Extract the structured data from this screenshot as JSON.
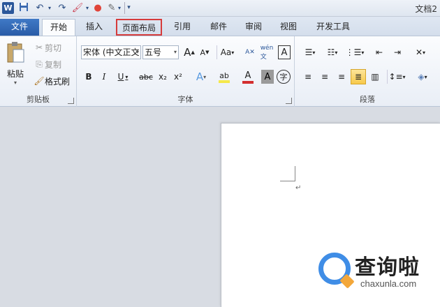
{
  "window": {
    "title": "文档2"
  },
  "qat": {
    "word_icon": "W",
    "save_icon": "💾",
    "undo_icon": "↶",
    "redo_icon": "↷",
    "paint_icon": "🖌",
    "color_icon": "●",
    "draw_icon": "✎",
    "more_icon": "▾"
  },
  "tabs": [
    {
      "label": "文件"
    },
    {
      "label": "开始"
    },
    {
      "label": "插入"
    },
    {
      "label": "页面布局"
    },
    {
      "label": "引用"
    },
    {
      "label": "邮件"
    },
    {
      "label": "审阅"
    },
    {
      "label": "视图"
    },
    {
      "label": "开发工具"
    }
  ],
  "clipboard": {
    "paste_label": "粘贴",
    "cut_label": "剪切",
    "copy_label": "复制",
    "format_painter_label": "格式刷",
    "group_label": "剪贴板"
  },
  "font": {
    "font_name": "宋体 (中文正文",
    "font_size": "五号",
    "grow_label": "A",
    "shrink_label": "A",
    "case_label": "Aa",
    "bold": "B",
    "italic": "I",
    "underline": "U",
    "strike": "abc",
    "subscript": "x₂",
    "superscript": "x²",
    "text_effect": "A",
    "highlight": "ab",
    "font_color": "A",
    "char_shade": "A",
    "enclose": "字",
    "group_label": "字体"
  },
  "paragraph": {
    "group_label": "段落"
  },
  "watermark": {
    "text": "查询啦",
    "sub": "chaxunla.com"
  },
  "colors": {
    "accent": "#2b579a",
    "file_tab": "#2a5ca7",
    "highlight_box": "#d63b3b",
    "font_red": "#d32f2f",
    "highlight_yellow": "#f5e84a"
  }
}
